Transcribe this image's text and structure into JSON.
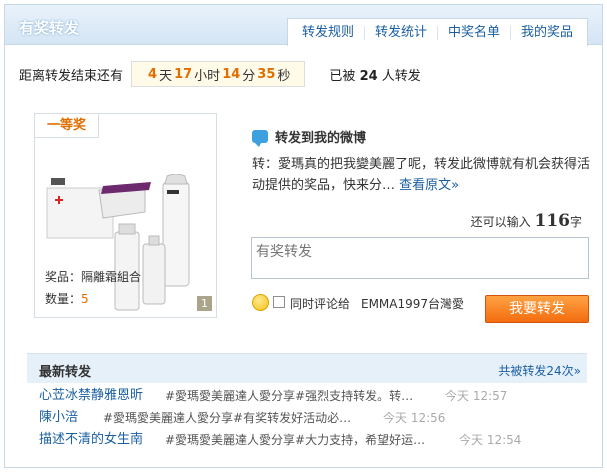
{
  "header": {
    "title": "有奖转发",
    "tabs": [
      "转发规则",
      "转发统计",
      "中奖名单",
      "我的奖品"
    ]
  },
  "countdown": {
    "label": "距离转发结束还有",
    "days": "4",
    "days_unit": "天",
    "hours": "17",
    "hours_unit": "小时",
    "minutes": "14",
    "minutes_unit": "分",
    "seconds": "35",
    "seconds_unit": "秒",
    "forwarded_prefix": "已被",
    "forwarded_count": "24",
    "forwarded_suffix": "人转发"
  },
  "prize": {
    "badge": "一等奖",
    "name_label": "奖品：",
    "name": "隔離霜組合",
    "qty_label": "数量：",
    "qty": "5",
    "image_count": "1"
  },
  "forward": {
    "title": "转发到我的微博",
    "quote": "转：愛瑪真的把我變美麗了呢，转发此微博就有机会获得活动提供的奖品，快来分…",
    "view_original": "查看原文»",
    "remain_prefix": "还可以输入",
    "remain_count": "116",
    "remain_suffix": "字",
    "placeholder": "有奖转发",
    "comment_label": "同时评论给",
    "account": "EMMA1997台灣愛",
    "submit": "我要转发"
  },
  "latest": {
    "title": "最新转发",
    "total": "共被转发24次»",
    "items": [
      {
        "user": "心苙冰禁静雅恩昕",
        "text": "#愛瑪愛美麗達人愛分享#强烈支持转发。转…",
        "time": "今天 12:57"
      },
      {
        "user": "陳小涪",
        "text": "#愛瑪愛美麗達人愛分享#有奖转发好活动必…",
        "time": "今天 12:56"
      },
      {
        "user": "描述不清的女生南",
        "text": "#愛瑪愛美麗達人愛分享#大力支持，希望好运…",
        "time": "今天 12:54"
      }
    ]
  }
}
